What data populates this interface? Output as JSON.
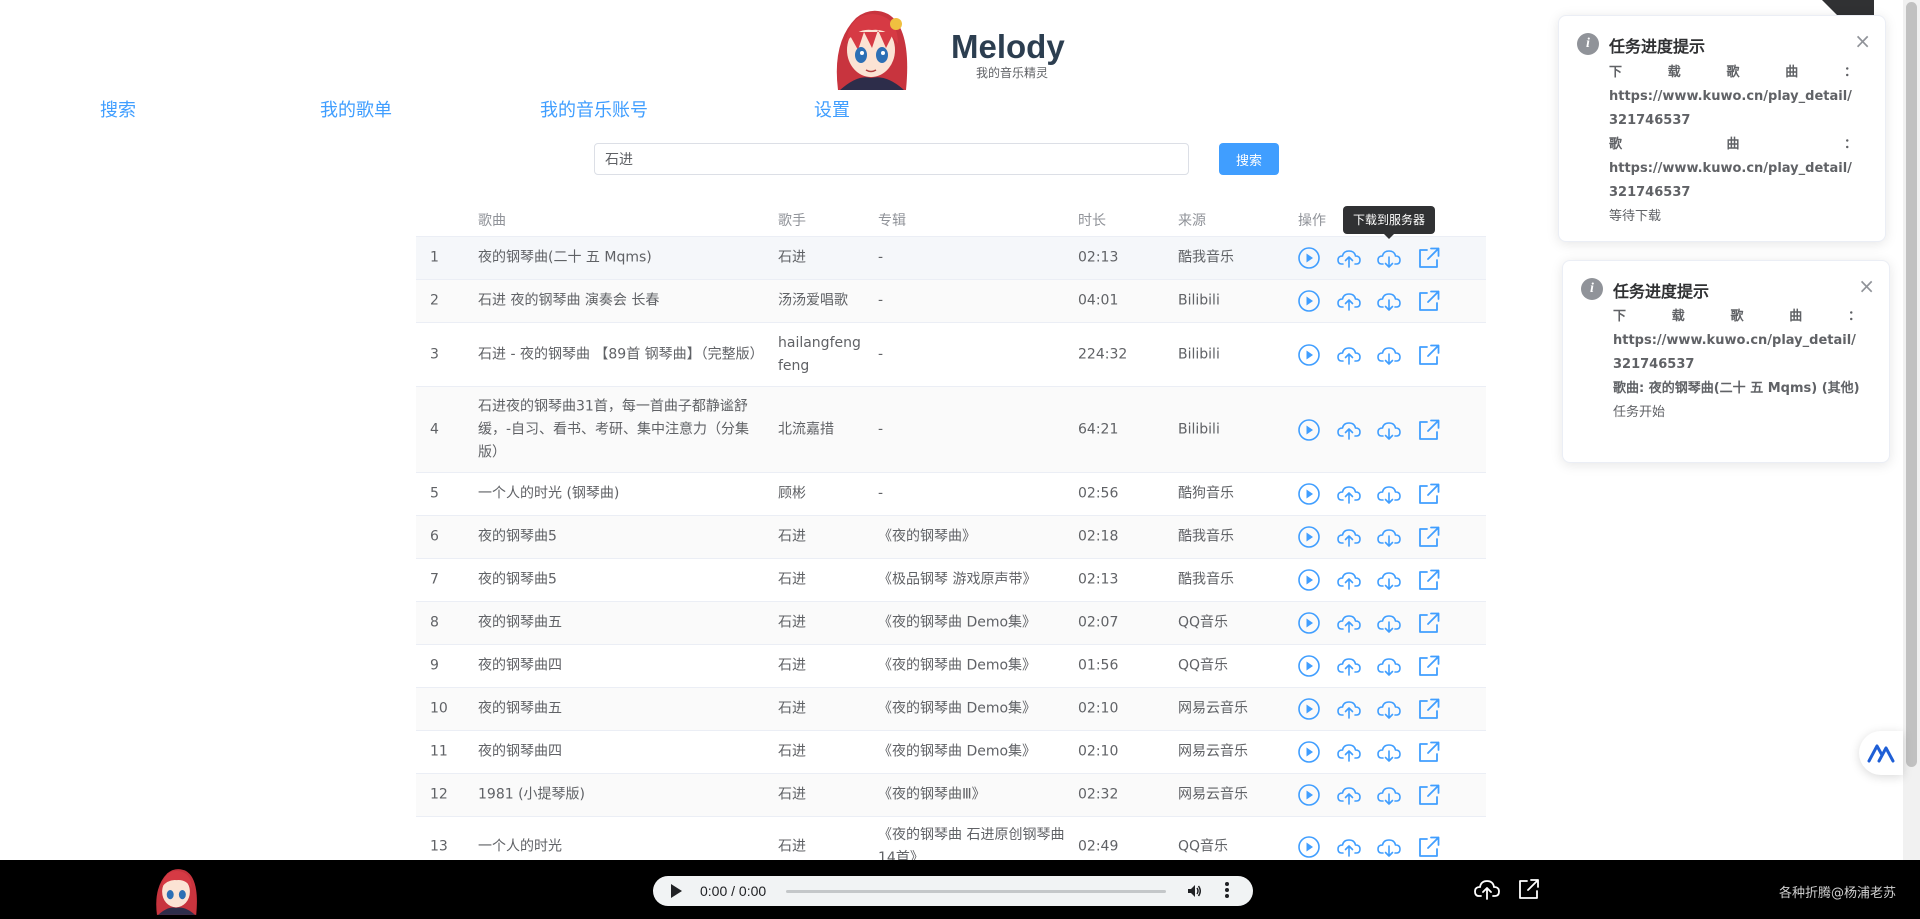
{
  "brand": {
    "title": "Melody",
    "subtitle": "我的音乐精灵"
  },
  "nav": [
    {
      "label": "搜索"
    },
    {
      "label": "我的歌单"
    },
    {
      "label": "我的音乐账号"
    },
    {
      "label": "设置"
    }
  ],
  "search": {
    "value": "石进",
    "button": "搜索"
  },
  "table": {
    "headers": {
      "song": "歌曲",
      "singer": "歌手",
      "album": "专辑",
      "duration": "时长",
      "source": "来源",
      "ops": "操作"
    },
    "rows": [
      {
        "idx": "1",
        "song": "夜的钢琴曲(二十 五 Mqms)",
        "singer": "石进",
        "album": "-",
        "duration": "02:13",
        "source": "酷我音乐"
      },
      {
        "idx": "2",
        "song": "石进 夜的钢琴曲 演奏会 长春",
        "singer": "汤汤爱唱歌",
        "album": "-",
        "duration": "04:01",
        "source": "Bilibili"
      },
      {
        "idx": "3",
        "song": "石进 - 夜的钢琴曲 【89首 钢琴曲】（完整版）",
        "singer": "hailangfengfeng",
        "album": "-",
        "duration": "224:32",
        "source": "Bilibili"
      },
      {
        "idx": "4",
        "song": "石进夜的钢琴曲31首，每一首曲子都静谧舒缓，-自习、看书、考研、集中注意力（分集版）",
        "singer": "北流嘉措",
        "album": "-",
        "duration": "64:21",
        "source": "Bilibili"
      },
      {
        "idx": "5",
        "song": "一个人的时光 (钢琴曲)",
        "singer": "顾彬",
        "album": "-",
        "duration": "02:56",
        "source": "酷狗音乐"
      },
      {
        "idx": "6",
        "song": "夜的钢琴曲5",
        "singer": "石进",
        "album": "《夜的钢琴曲》",
        "duration": "02:18",
        "source": "酷我音乐"
      },
      {
        "idx": "7",
        "song": "夜的钢琴曲5",
        "singer": "石进",
        "album": "《极品钢琴 游戏原声带》",
        "duration": "02:13",
        "source": "酷我音乐"
      },
      {
        "idx": "8",
        "song": "夜的钢琴曲五",
        "singer": "石进",
        "album": "《夜的钢琴曲 Demo集》",
        "duration": "02:07",
        "source": "QQ音乐"
      },
      {
        "idx": "9",
        "song": "夜的钢琴曲四",
        "singer": "石进",
        "album": "《夜的钢琴曲 Demo集》",
        "duration": "01:56",
        "source": "QQ音乐"
      },
      {
        "idx": "10",
        "song": "夜的钢琴曲五",
        "singer": "石进",
        "album": "《夜的钢琴曲 Demo集》",
        "duration": "02:10",
        "source": "网易云音乐"
      },
      {
        "idx": "11",
        "song": "夜的钢琴曲四",
        "singer": "石进",
        "album": "《夜的钢琴曲 Demo集》",
        "duration": "02:10",
        "source": "网易云音乐"
      },
      {
        "idx": "12",
        "song": "1981 (小提琴版)",
        "singer": "石进",
        "album": "《夜的钢琴曲Ⅲ》",
        "duration": "02:32",
        "source": "网易云音乐"
      },
      {
        "idx": "13",
        "song": "一个人的时光",
        "singer": "石进",
        "album": "《夜的钢琴曲 石进原创钢琴曲14首》",
        "duration": "02:49",
        "source": "QQ音乐"
      }
    ]
  },
  "tooltip": "下载到服务器",
  "notifications": [
    {
      "title": "任务进度提示",
      "label1": "下载歌曲：",
      "line1": "https://www.kuwo.cn/play_detail/321746537",
      "label2": "歌曲：",
      "line2": "https://www.kuwo.cn/play_detail/321746537",
      "status": "等待下载"
    },
    {
      "title": "任务进度提示",
      "label1": "下载歌曲：",
      "line1": "https://www.kuwo.cn/play_detail/321746537",
      "line2": "歌曲: 夜的钢琴曲(二十 五 Mqms) (其他)",
      "status": "任务开始"
    }
  ],
  "player": {
    "time": "0:00 / 0:00",
    "progress": 0
  },
  "footer": {
    "credit": "各种折腾@杨浦老苏"
  },
  "colors": {
    "accent": "#409eff",
    "footer_bg": "#000000",
    "tooltip_bg": "#303133"
  }
}
